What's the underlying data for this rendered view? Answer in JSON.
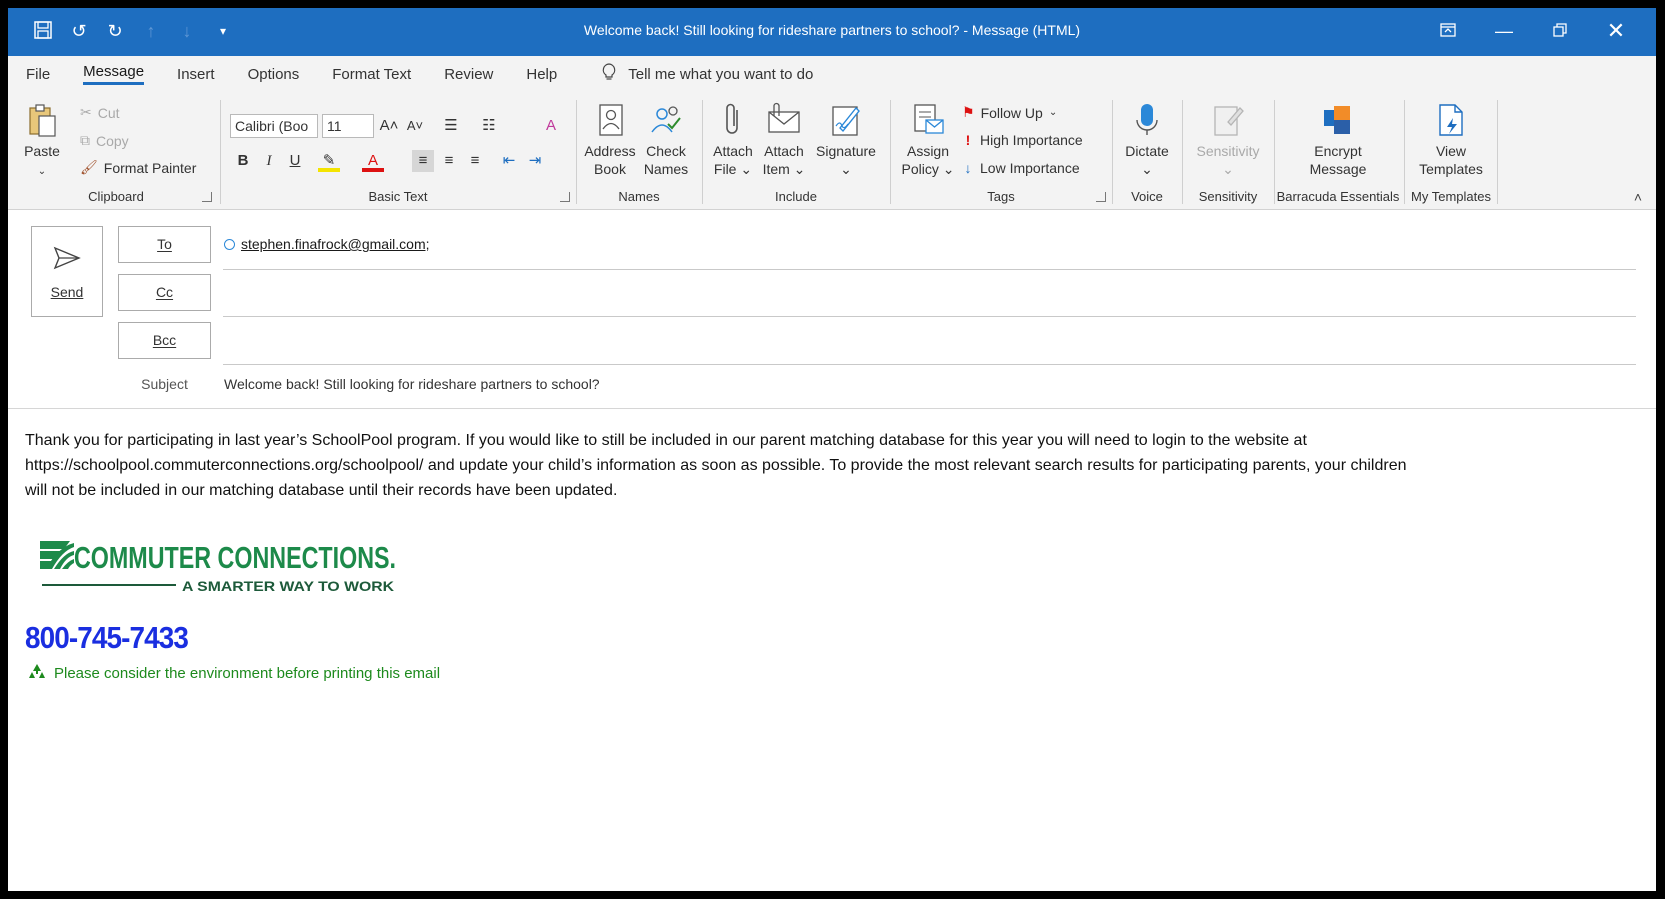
{
  "window": {
    "title": "Welcome back!  Still looking for rideshare partners to school?  -  Message (HTML)",
    "qat": [
      "save-icon",
      "undo-icon",
      "redo-icon",
      "up-arrow-icon",
      "down-arrow-icon",
      "customize-icon"
    ],
    "controls": [
      "ribbon-display-icon",
      "minimize-icon",
      "restore-icon",
      "close-icon"
    ]
  },
  "tabs": [
    "File",
    "Message",
    "Insert",
    "Options",
    "Format Text",
    "Review",
    "Help"
  ],
  "tell_me": "Tell me what you want to do",
  "ribbon": {
    "clipboard": {
      "paste": "Paste",
      "cut": "Cut",
      "copy": "Copy",
      "format_painter": "Format Painter",
      "label": "Clipboard"
    },
    "basic_text": {
      "font": "Calibri (Boo",
      "size": "11",
      "bold": "B",
      "italic": "I",
      "underline": "U",
      "label": "Basic Text"
    },
    "names": {
      "address_book_1": "Address",
      "address_book_2": "Book",
      "check_names_1": "Check",
      "check_names_2": "Names",
      "label": "Names"
    },
    "include": {
      "attach_file_1": "Attach",
      "attach_file_2": "File",
      "attach_item_1": "Attach",
      "attach_item_2": "Item",
      "signature": "Signature",
      "label": "Include"
    },
    "tags": {
      "assign_policy_1": "Assign",
      "assign_policy_2": "Policy",
      "follow_up": "Follow Up",
      "high_importance": "High Importance",
      "low_importance": "Low Importance",
      "label": "Tags"
    },
    "voice": {
      "dictate": "Dictate",
      "label": "Voice"
    },
    "sensitivity": {
      "button": "Sensitivity",
      "label": "Sensitivity"
    },
    "barracuda": {
      "encrypt_1": "Encrypt",
      "encrypt_2": "Message",
      "label": "Barracuda Essentials"
    },
    "templates": {
      "view_1": "View",
      "view_2": "Templates",
      "label": "My Templates"
    }
  },
  "compose": {
    "send": "Send",
    "to_button": "To",
    "cc_button": "Cc",
    "bcc_button": "Bcc",
    "to_value": "stephen.finafrock@gmail.com;",
    "subject_label": "Subject",
    "subject_value": "Welcome back!  Still looking for rideshare partners to school?"
  },
  "message": {
    "line1": "Thank you for participating in last year’s SchoolPool program.  If you would like to still be included in our parent matching database for this year you will need to login to the website at",
    "line2": "https://schoolpool.commuterconnections.org/schoolpool/ and update your child’s information as soon as possible.  To provide the most relevant search results for participating parents, your children",
    "line3": "will not be included in our matching database until their records have been updated.",
    "logo_text": "COMMUTER CONNECTIONS.",
    "logo_tagline": "A SMARTER WAY TO WORK",
    "phone": "800-745-7433",
    "environment_note": "Please consider the environment before printing this email"
  },
  "colors": {
    "title_bar": "#1e6ec0",
    "phone": "#1a2ee0",
    "logo_green": "#1d8a4a",
    "env_note": "#1d8a1d"
  }
}
